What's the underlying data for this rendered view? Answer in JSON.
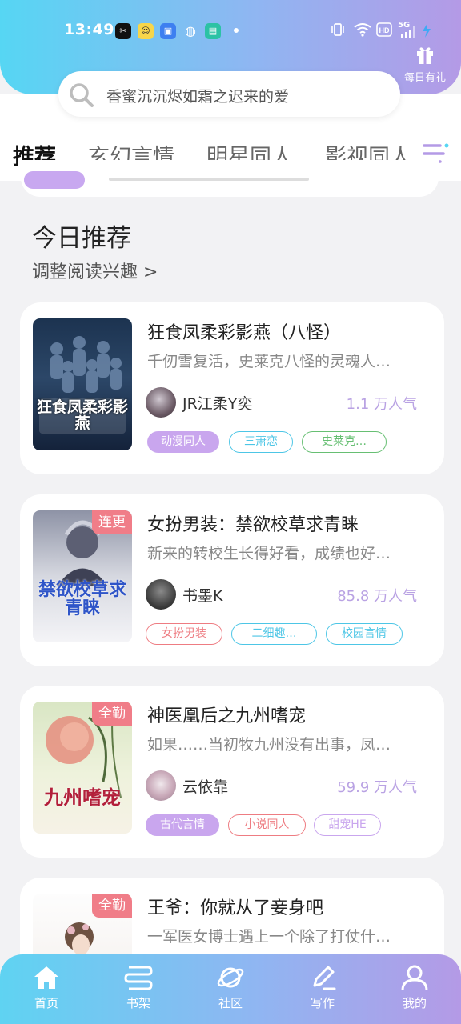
{
  "status_bar": {
    "time": "13:49",
    "network": "5G"
  },
  "header": {
    "gift_label": "每日有礼"
  },
  "search": {
    "placeholder": "香蜜沉沉烬如霜之迟来的爱"
  },
  "tabs": [
    {
      "label": "推荐"
    },
    {
      "label": "玄幻言情"
    },
    {
      "label": "明星同人"
    },
    {
      "label": "影视同人"
    }
  ],
  "section": {
    "title": "今日推荐",
    "subtitle": "调整阅读兴趣 >"
  },
  "books": [
    {
      "title": "狂食凤柔彩影燕（八怪）",
      "desc": "千仞雪复活，史莱克八怪的灵魂人…",
      "author": "JR江柔Y奕",
      "popularity": "1.1 万人气",
      "badge": "",
      "cover_text": "狂食凤柔彩影燕",
      "tags": [
        {
          "label": "动漫同人",
          "color": "#c9a6ee",
          "filled": true
        },
        {
          "label": "三萧恋",
          "color": "#4dc6e6",
          "filled": false
        },
        {
          "label": "史莱克…",
          "color": "#67bf73",
          "filled": false
        }
      ]
    },
    {
      "title": "女扮男装：禁欲校草求青睐",
      "desc": "新来的转校生长得好看，成绩也好…",
      "author": "书墨K",
      "popularity": "85.8 万人气",
      "badge": "连更",
      "cover_text": "禁欲校草求青睐",
      "tags": [
        {
          "label": "女扮男装",
          "color": "#ee7c82",
          "filled": false
        },
        {
          "label": "二细趣…",
          "color": "#4dc6e6",
          "filled": false
        },
        {
          "label": "校园言情",
          "color": "#4dc6e6",
          "filled": false
        }
      ]
    },
    {
      "title": "神医凰后之九州嗜宠",
      "desc": "如果……当初牧九州没有出事，凤…",
      "author": "云依靠",
      "popularity": "59.9 万人气",
      "badge": "全勤",
      "cover_text": "九州嗜宠",
      "tags": [
        {
          "label": "古代言情",
          "color": "#c9a6ee",
          "filled": true
        },
        {
          "label": "小说同人",
          "color": "#ee7c82",
          "filled": false
        },
        {
          "label": "甜宠HE",
          "color": "#c9a6ee",
          "filled": false
        }
      ]
    },
    {
      "title": "王爷：你就从了妾身吧",
      "desc": "一军医女博士遇上一个除了打仗什…",
      "badge": "全勤"
    }
  ],
  "bottom_nav": [
    {
      "label": "首页"
    },
    {
      "label": "书架"
    },
    {
      "label": "社区"
    },
    {
      "label": "写作"
    },
    {
      "label": "我的"
    }
  ]
}
